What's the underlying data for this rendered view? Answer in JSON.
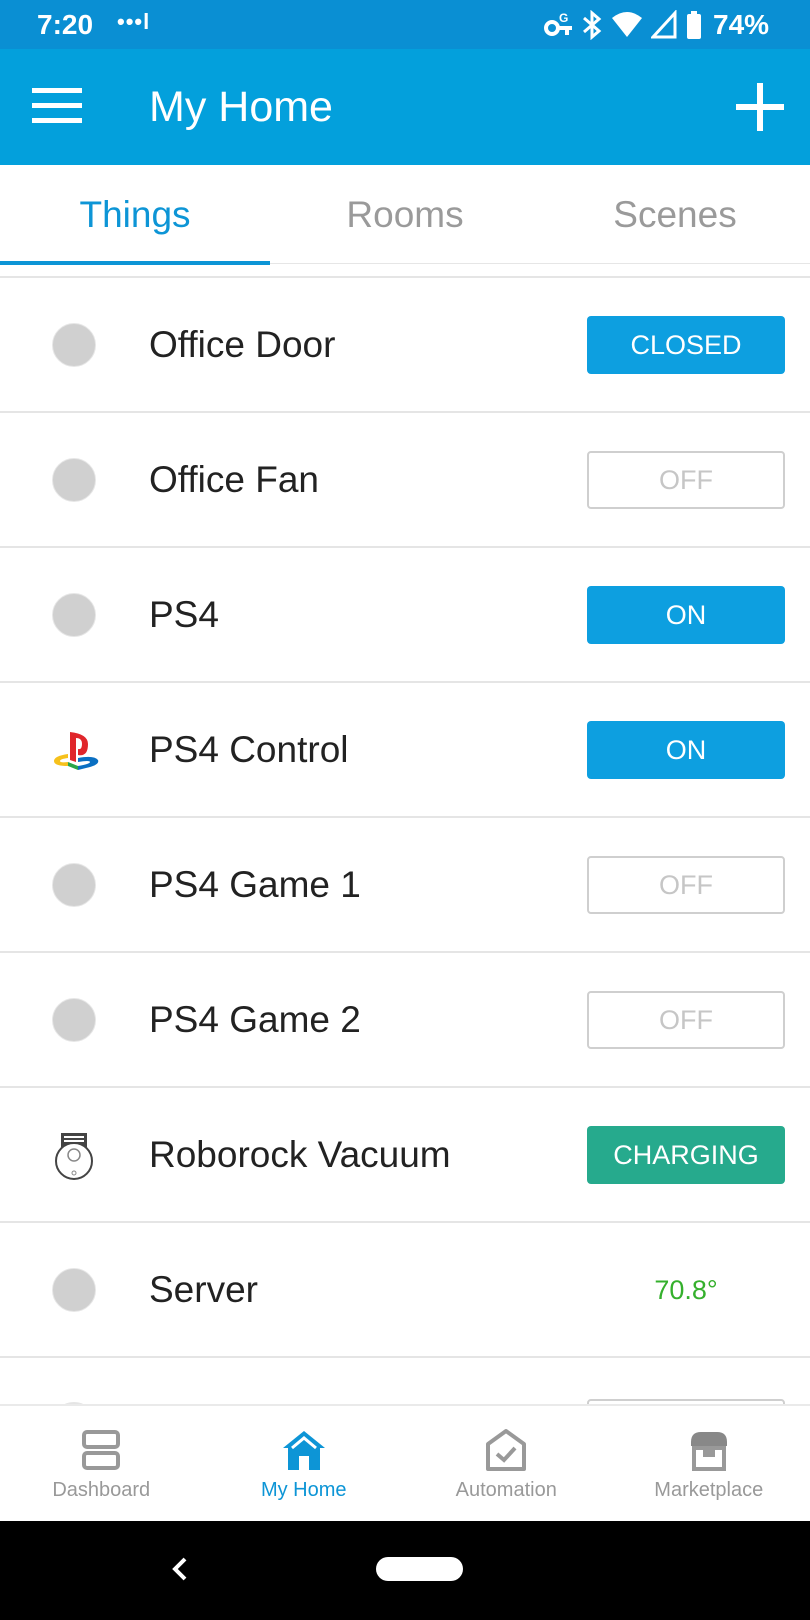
{
  "status_bar": {
    "time": "7:20",
    "notification_dots": "•••l",
    "battery_percent": "74%"
  },
  "header": {
    "title": "My Home",
    "menu_icon": "hamburger-menu-icon",
    "add_icon": "plus-icon"
  },
  "tabs": [
    {
      "label": "Things",
      "active": true
    },
    {
      "label": "Rooms",
      "active": false
    },
    {
      "label": "Scenes",
      "active": false
    }
  ],
  "things": [
    {
      "name": "Office Door",
      "icon": "status-dot-icon",
      "state": "CLOSED",
      "state_style": "on"
    },
    {
      "name": "Office Fan",
      "icon": "status-dot-icon",
      "state": "OFF",
      "state_style": "off"
    },
    {
      "name": "PS4",
      "icon": "status-dot-icon",
      "state": "ON",
      "state_style": "on"
    },
    {
      "name": "PS4 Control",
      "icon": "playstation-logo-icon",
      "state": "ON",
      "state_style": "on"
    },
    {
      "name": "PS4 Game 1",
      "icon": "status-dot-icon",
      "state": "OFF",
      "state_style": "off"
    },
    {
      "name": "PS4 Game 2",
      "icon": "status-dot-icon",
      "state": "OFF",
      "state_style": "off"
    },
    {
      "name": "Roborock Vacuum",
      "icon": "robot-vacuum-icon",
      "state": "CHARGING",
      "state_style": "charging"
    },
    {
      "name": "Server",
      "icon": "status-dot-icon",
      "state": "70.8°",
      "state_style": "temperature"
    }
  ],
  "bottom_nav": [
    {
      "label": "Dashboard",
      "icon": "dashboard-icon",
      "active": false
    },
    {
      "label": "My Home",
      "icon": "home-icon",
      "active": true
    },
    {
      "label": "Automation",
      "icon": "automation-icon",
      "active": false
    },
    {
      "label": "Marketplace",
      "icon": "marketplace-icon",
      "active": false
    }
  ],
  "colors": {
    "status_bar": "#0a8fd3",
    "app_bar": "#03a0dc",
    "accent": "#0d95d6",
    "on_button": "#0d9fe0",
    "charging_button": "#26aa8d",
    "temperature_text": "#35b02d",
    "inactive_text": "#999999"
  }
}
